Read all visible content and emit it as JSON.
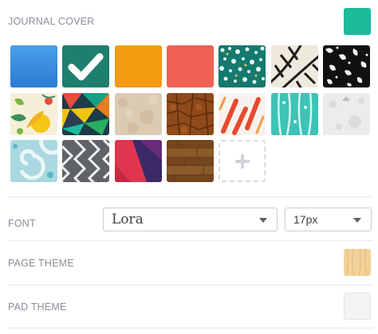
{
  "journal_cover": {
    "label": "JOURNAL COVER",
    "current_color": "#1abc9c",
    "swatches": [
      {
        "name": "blue",
        "color": "#3498db"
      },
      {
        "name": "teal-selected",
        "color": "#1e7f6e",
        "selected": true
      },
      {
        "name": "orange",
        "color": "#f39c12"
      },
      {
        "name": "coral",
        "color": "#ef6152"
      },
      {
        "name": "pattern-teal-dots"
      },
      {
        "name": "pattern-leaf-lines"
      },
      {
        "name": "pattern-black-white"
      },
      {
        "name": "pattern-floral-yellow"
      },
      {
        "name": "pattern-geometric"
      },
      {
        "name": "pattern-beige-paper"
      },
      {
        "name": "pattern-brown-leather"
      },
      {
        "name": "pattern-red-white-strokes"
      },
      {
        "name": "pattern-teal-stripes"
      },
      {
        "name": "pattern-white-paper"
      },
      {
        "name": "pattern-swirl-blue"
      },
      {
        "name": "pattern-gray-chevron"
      },
      {
        "name": "pattern-red-purple"
      },
      {
        "name": "pattern-wood"
      }
    ],
    "add_icon": "plus-icon"
  },
  "font": {
    "label": "FONT",
    "family": "Lora",
    "size": "17px"
  },
  "page_theme": {
    "label": "PAGE THEME",
    "swatch": "wood-light"
  },
  "pad_theme": {
    "label": "PAD THEME",
    "swatch": "plain-light"
  }
}
